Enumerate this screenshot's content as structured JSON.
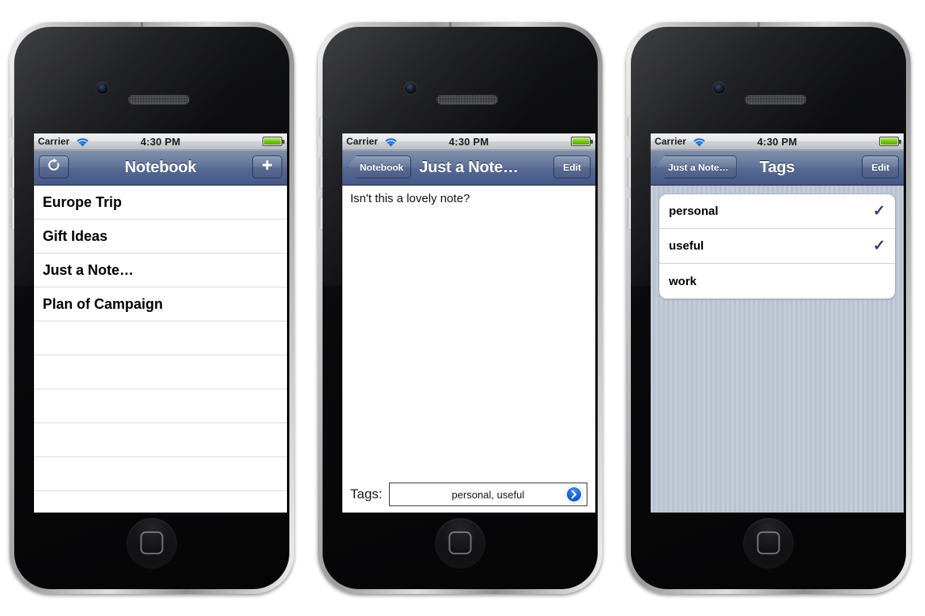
{
  "status_bar": {
    "carrier": "Carrier",
    "time": "4:30 PM",
    "wifi_icon": "wifi-icon",
    "battery_icon": "battery-icon"
  },
  "phone_1": {
    "nav": {
      "title": "Notebook",
      "left_button_icon": "refresh-icon",
      "right_button_icon": "plus-icon"
    },
    "notes": [
      "Europe Trip",
      "Gift Ideas",
      "Just a Note…",
      "Plan of Campaign"
    ],
    "empty_row_count": 6
  },
  "phone_2": {
    "nav": {
      "back_label": "Notebook",
      "title": "Just a Note…",
      "edit_label": "Edit"
    },
    "note_body": "Isn't this a lovely note?",
    "tags_label": "Tags:",
    "tags_value": "personal, useful",
    "disclosure_icon": "chevron-right-circle-icon"
  },
  "phone_3": {
    "nav": {
      "back_label": "Just a Note…",
      "title": "Tags",
      "edit_label": "Edit"
    },
    "tags": [
      {
        "label": "personal",
        "checked": true,
        "check_glyph": "✓"
      },
      {
        "label": "useful",
        "checked": true,
        "check_glyph": "✓"
      },
      {
        "label": "work",
        "checked": false,
        "check_glyph": ""
      }
    ]
  },
  "colors": {
    "nav_bar_top": "#7f8fa9",
    "nav_bar_bottom": "#3d4e7e",
    "checkmark": "#2b3f75",
    "disclosure_blue": "#1a64cf",
    "battery_green": "#72c412",
    "wifi_blue": "#1d6fd0",
    "grouped_bg": "#bfc7d4"
  }
}
